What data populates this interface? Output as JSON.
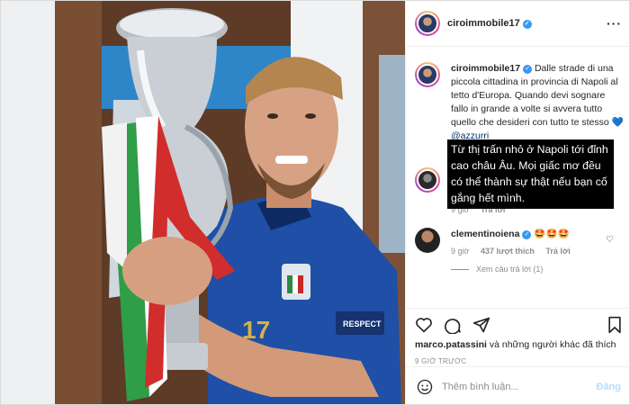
{
  "post": {
    "username": "ciroimmobile17",
    "more_icon": "more-horizontal-icon"
  },
  "caption": {
    "username": "ciroimmobile17",
    "text": "Dalle strade di una piccola cittadina in provincia di Napoli al tetto d'Europa. Quando devi sognare fallo in grande a volte si avvera tutto quello che desideri con tutto te stesso",
    "heart": "💙",
    "mention": "@azzurri"
  },
  "translation_overlay": {
    "text": "Từ thị trấn nhỏ ở Napoli tới đỉnh cao châu Âu. Mọi giấc mơ đều có thể thành sự thật nếu bạn cố gắng hết mình."
  },
  "comments": [
    {
      "username": "",
      "time": "9 giờ",
      "reply_label": "Trả lời"
    },
    {
      "username": "clementinoiena",
      "text": "🤩🤩🤩",
      "time": "9 giờ",
      "likes": "437 lượt thích",
      "reply_label": "Trả lời",
      "view_replies": "Xem câu trả lời (1)"
    }
  ],
  "actions": {
    "liked_by_user": "marco.patassini",
    "liked_by_rest": "và những người khác đã thích",
    "timestamp": "9 GIỜ TRƯỚC"
  },
  "comment_box": {
    "placeholder": "Thêm bình luận...",
    "post_label": "Đăng"
  },
  "colors": {
    "verified": "#3897f0",
    "post_button_disabled": "#b2dffc",
    "link": "#00376b"
  }
}
